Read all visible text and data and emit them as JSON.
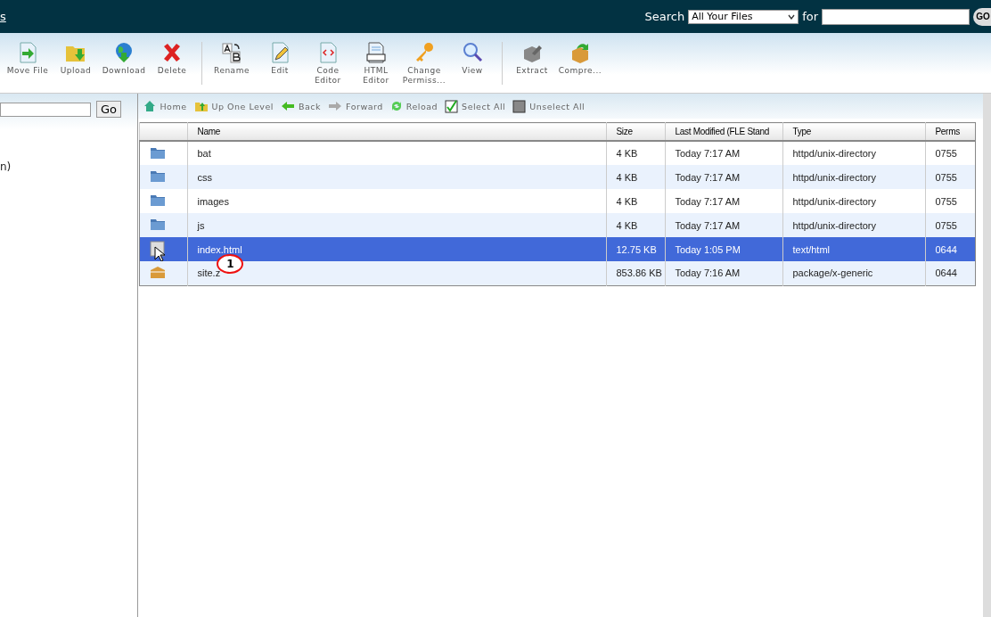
{
  "top_bar": {
    "cut_link": "s",
    "search_label": "Search",
    "search_scope": "All Your Files",
    "for_label": "for",
    "go_label": "GO"
  },
  "toolbar": [
    {
      "label": "Move File"
    },
    {
      "label": "Upload"
    },
    {
      "label": "Download"
    },
    {
      "label": "Delete"
    },
    {
      "label": "Rename"
    },
    {
      "label": "Edit"
    },
    {
      "label": "Code Editor"
    },
    {
      "label": "HTML Editor"
    },
    {
      "label": "Change Permiss..."
    },
    {
      "label": "View"
    },
    {
      "label": "Extract"
    },
    {
      "label": "Compre..."
    }
  ],
  "sidebar": {
    "go_label": "Go",
    "cut_text": "n)"
  },
  "nav": [
    {
      "label": "Home"
    },
    {
      "label": "Up One Level"
    },
    {
      "label": "Back"
    },
    {
      "label": "Forward"
    },
    {
      "label": "Reload"
    },
    {
      "label": "Select All"
    },
    {
      "label": "Unselect All"
    }
  ],
  "table": {
    "columns": [
      "Name",
      "Size",
      "Last Modified (FLE Stand",
      "Type",
      "Perms"
    ],
    "rows": [
      {
        "kind": "folder",
        "name": "bat",
        "size": "4 KB",
        "modified": "Today 7:17 AM",
        "type": "httpd/unix-directory",
        "perms": "0755",
        "selected": false
      },
      {
        "kind": "folder",
        "name": "css",
        "size": "4 KB",
        "modified": "Today 7:17 AM",
        "type": "httpd/unix-directory",
        "perms": "0755",
        "selected": false
      },
      {
        "kind": "folder",
        "name": "images",
        "size": "4 KB",
        "modified": "Today 7:17 AM",
        "type": "httpd/unix-directory",
        "perms": "0755",
        "selected": false
      },
      {
        "kind": "folder",
        "name": "js",
        "size": "4 KB",
        "modified": "Today 7:17 AM",
        "type": "httpd/unix-directory",
        "perms": "0755",
        "selected": false
      },
      {
        "kind": "file",
        "name": "index.html",
        "size": "12.75 KB",
        "modified": "Today 1:05 PM",
        "type": "text/html",
        "perms": "0644",
        "selected": true
      },
      {
        "kind": "package",
        "name": "site.z",
        "size": "853.86 KB",
        "modified": "Today 7:16 AM",
        "type": "package/x-generic",
        "perms": "0644",
        "selected": false
      }
    ]
  },
  "callout": {
    "label": "1"
  }
}
